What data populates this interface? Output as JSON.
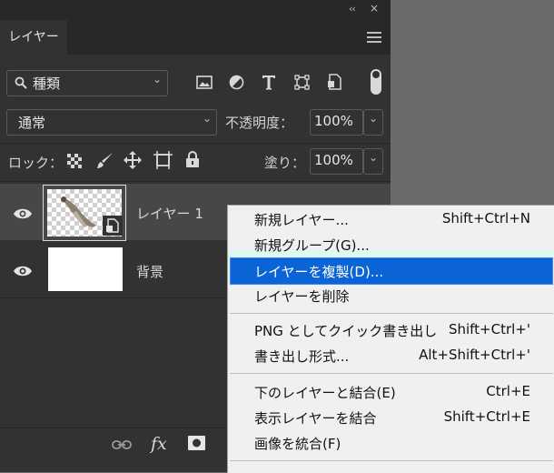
{
  "panel": {
    "collapse_glyph": "‹‹",
    "close_glyph": "×",
    "tab_label": "レイヤー"
  },
  "filter": {
    "kind_label": "種類",
    "search_glyph": "🔍",
    "chevron": "⌄"
  },
  "blend": {
    "mode": "通常",
    "opacity_label": "不透明度：",
    "opacity_value": "100%"
  },
  "lock": {
    "label": "ロック：",
    "fill_label": "塗り：",
    "fill_value": "100%"
  },
  "layers": [
    {
      "name": "レイヤー 1",
      "selected": true
    },
    {
      "name": "背景",
      "selected": false
    }
  ],
  "bottom": {
    "fx_label": "fx"
  },
  "context_menu": {
    "items": [
      {
        "label": "新規レイヤー...",
        "shortcut": "Shift+Ctrl+N"
      },
      {
        "label": "新規グループ(G)...",
        "shortcut": ""
      },
      {
        "label": "レイヤーを複製(D)...",
        "shortcut": "",
        "highlighted": true
      },
      {
        "label": "レイヤーを削除",
        "shortcut": ""
      },
      {
        "label": "PNG としてクイック書き出し",
        "shortcut": "Shift+Ctrl+'"
      },
      {
        "label": "書き出し形式...",
        "shortcut": "Alt+Shift+Ctrl+'"
      },
      {
        "label": "下のレイヤーと結合(E)",
        "shortcut": "Ctrl+E"
      },
      {
        "label": "表示レイヤーを結合",
        "shortcut": "Shift+Ctrl+E"
      },
      {
        "label": "画像を統合(F)",
        "shortcut": ""
      }
    ],
    "highlight_color": "#0a64d6"
  }
}
